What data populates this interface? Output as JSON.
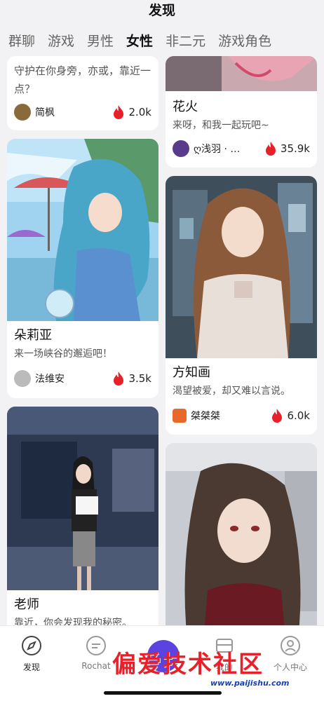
{
  "header": {
    "title": "发现",
    "tabs": [
      "群聊",
      "游戏",
      "男性",
      "女性",
      "非二元",
      "游戏角色"
    ],
    "active_tab": "女性"
  },
  "cards": {
    "left": [
      {
        "name": "",
        "desc": "守护在你身旁，亦或，靠近一点？",
        "author": "简枫",
        "heat": "2.0k",
        "colors": {
          "avatar": "#8a6a3a"
        }
      },
      {
        "name": "朵莉亚",
        "desc": "来一场峡谷的邂逅吧！",
        "author": "法维安",
        "heat": "3.5k",
        "colors": {
          "sky": "#7fc0ea",
          "hair": "#4aa6c8",
          "dress": "#5a8fd0",
          "avatar": "#999999"
        }
      },
      {
        "name": "老师",
        "desc": "靠近，你会发现我的秘密。",
        "author": "",
        "heat": "",
        "colors": {
          "wall": "#3a4a6a",
          "skirt": "#888888",
          "avatar": "#777777"
        }
      }
    ],
    "right": [
      {
        "name": "花火",
        "desc": "来呀，和我一起玩吧~",
        "author": "ღ浅羽 · …",
        "heat": "35.9k",
        "colors": {
          "img": "#e9a4b4",
          "avatar": "#5a3a8a"
        }
      },
      {
        "name": "方知画",
        "desc": "渴望被爱，却又难以言说。",
        "author": "桀桀桀",
        "heat": "6.0k",
        "colors": {
          "bg": "#4a5a66",
          "hair": "#8a5a3a",
          "shirt": "#e8e0d8",
          "avatar": "#e86a2a"
        }
      },
      {
        "name": "",
        "desc": "",
        "author": "",
        "heat": "",
        "colors": {
          "bg": "#c8ccd2",
          "hair": "#4a3a32",
          "skin": "#f2dcd0",
          "cloth": "#6a1a22"
        }
      }
    ]
  },
  "bottom_nav": {
    "items": [
      {
        "label": "发现",
        "icon": "compass-icon"
      },
      {
        "label": "Rochat",
        "icon": "chat-icon"
      },
      {
        "label": "",
        "icon": "create-icon"
      },
      {
        "label": "我的",
        "icon": "inbox-icon"
      },
      {
        "label": "个人中心",
        "icon": "profile-icon"
      }
    ]
  },
  "watermark": {
    "text": "偏爱技术社区",
    "url": "www.paijishu.com"
  },
  "accent": {
    "flame": "#e8202a",
    "brand": "#5b43e0"
  }
}
